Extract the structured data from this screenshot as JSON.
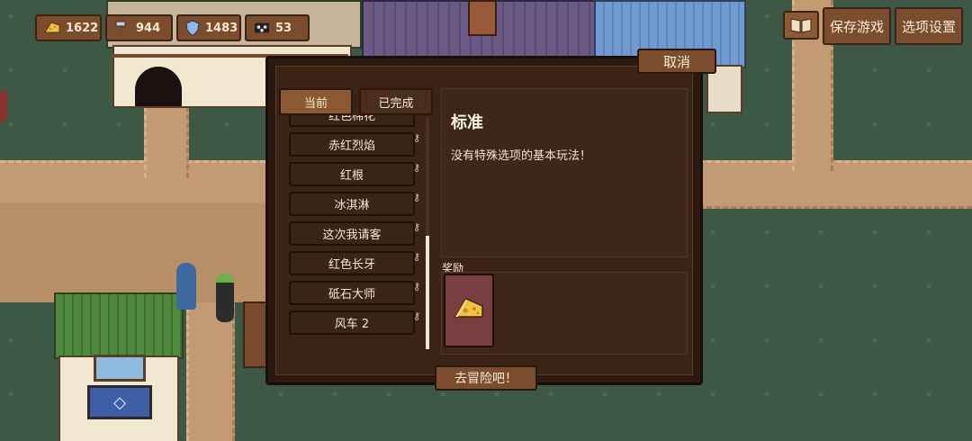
{
  "hud": {
    "cheese": "1622",
    "hammer": "944",
    "shield": "1483",
    "paws": "53"
  },
  "top_buttons": {
    "save": "保存游戏",
    "options": "选项设置"
  },
  "modal": {
    "cancel": "取消",
    "tabs": {
      "current": "当前",
      "completed": "已完成"
    },
    "items": [
      "红色棉花",
      "赤红烈焰",
      "红根",
      "冰淇淋",
      "这次我请客",
      "红色长牙",
      "砥石大师",
      "风车 2"
    ],
    "detail_title": "标准",
    "detail_desc": "没有特殊选项的基本玩法！",
    "reward_label": "奖励",
    "go_button": "去冒险吧！"
  },
  "icons": {
    "hud": [
      "cheese-icon",
      "hammer-icon",
      "shield-icon",
      "paw-icon"
    ],
    "book": "book-icon",
    "key": "key-icon",
    "reward": "cheese-icon"
  }
}
